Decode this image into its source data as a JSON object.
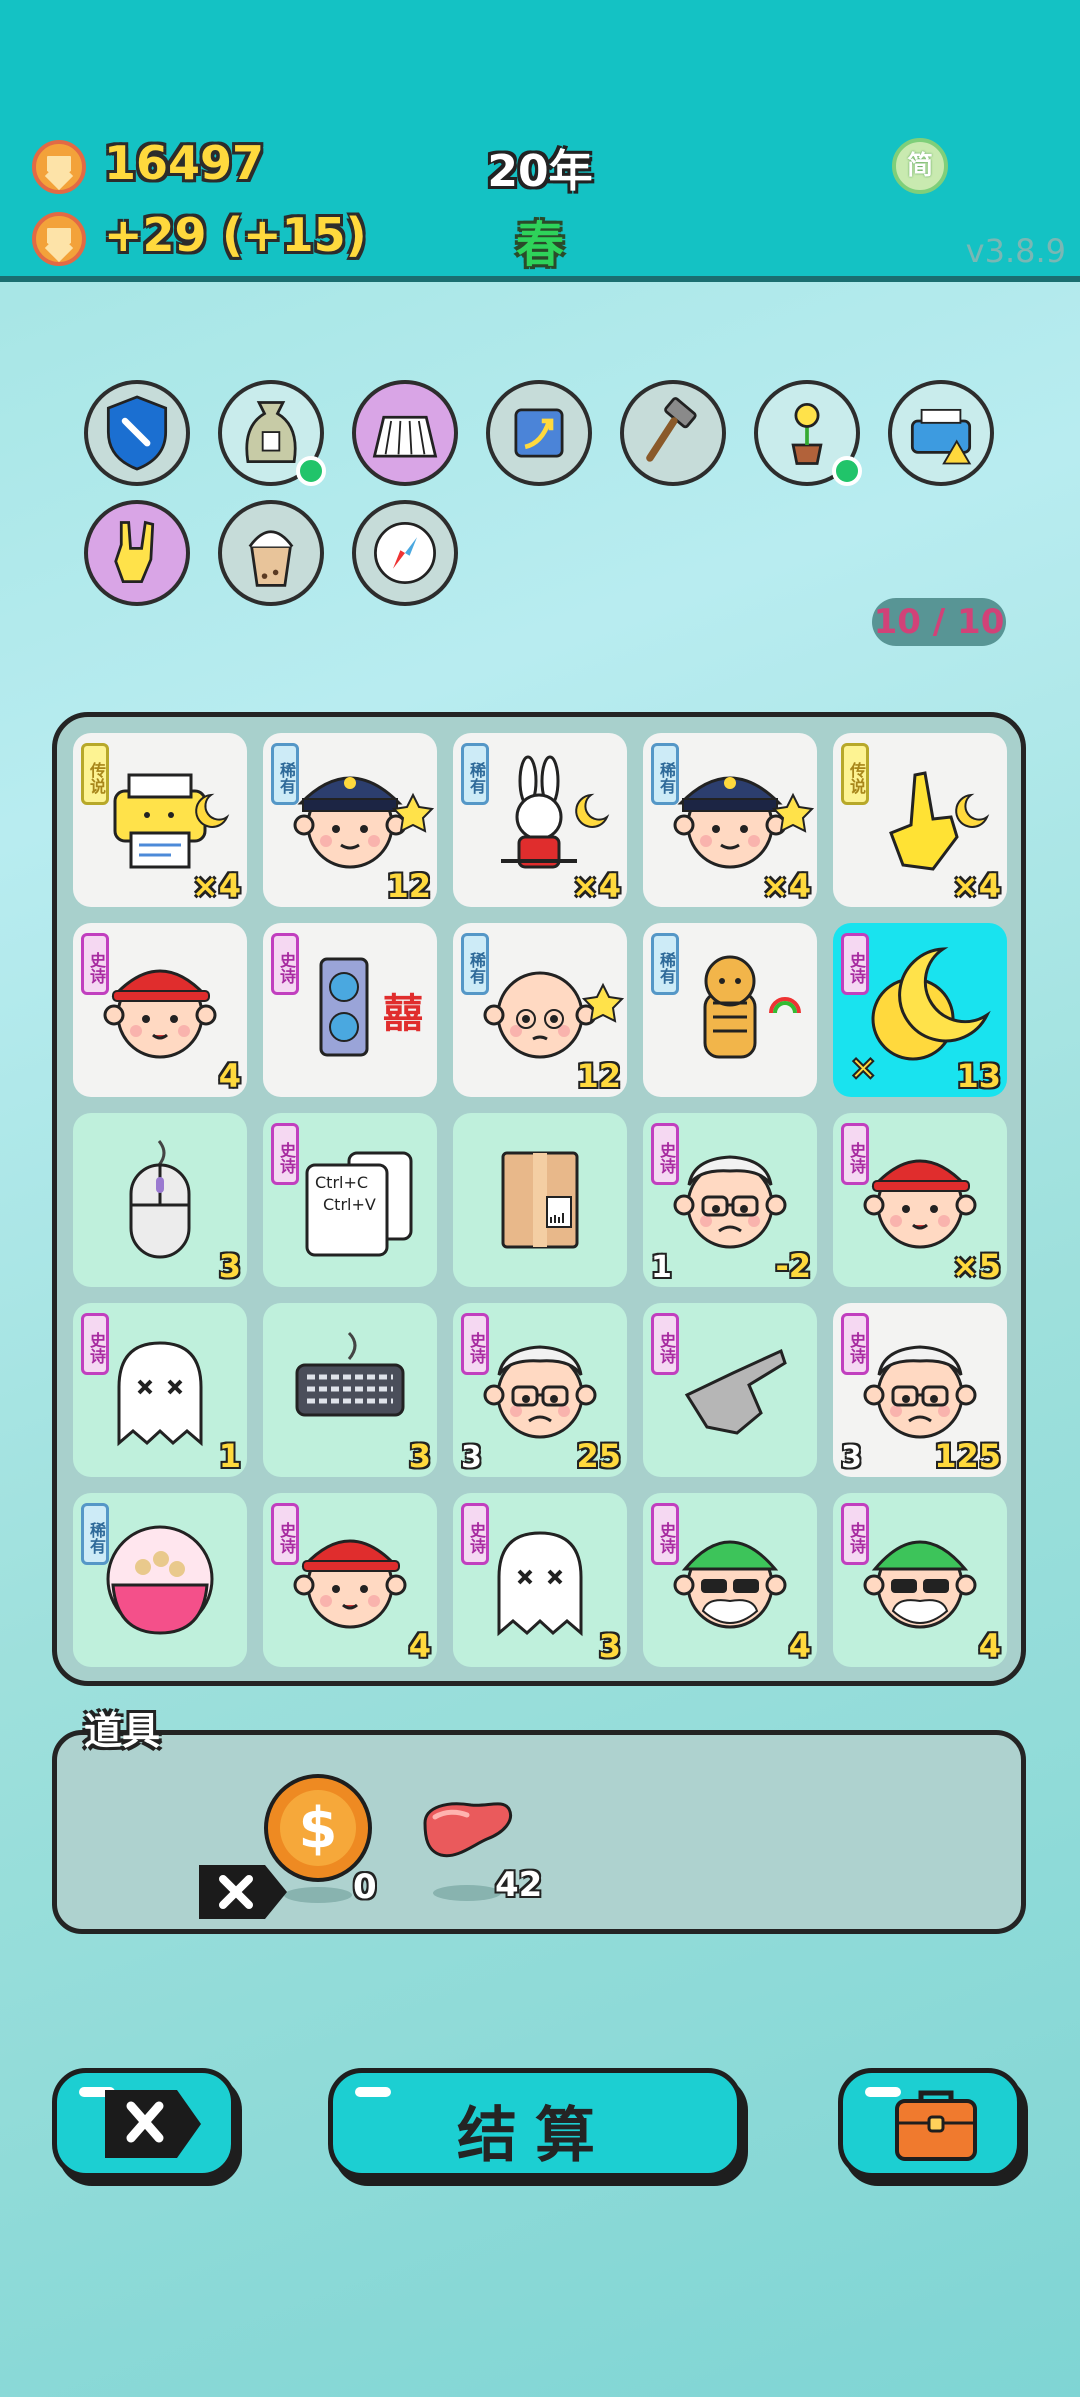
{
  "header": {
    "coins": "16497",
    "income": "+29",
    "bonus": "(+15)",
    "year": "20年",
    "season": "春",
    "lang_toggle": "简",
    "version": "v3.8.9"
  },
  "relics": [
    {
      "name": "shield-wrench",
      "bg": "#c6dcd9"
    },
    {
      "name": "money-bag",
      "bg": "#c9ecec",
      "dot": true
    },
    {
      "name": "pleated-skirt",
      "bg": "#d9a5e6"
    },
    {
      "name": "growth-arrow",
      "bg": "#c6dcd9"
    },
    {
      "name": "hammer",
      "bg": "#c6dcd9"
    },
    {
      "name": "potted-flower",
      "bg": "#c9ecec",
      "dot": true
    },
    {
      "name": "broken-printer",
      "bg": "#c9ecec"
    },
    {
      "name": "rock-hand",
      "bg": "#d9a5e6"
    },
    {
      "name": "bubble-tea",
      "bg": "#c6dcd9"
    },
    {
      "name": "compass",
      "bg": "#c6dcd9"
    }
  ],
  "relic_counter": "10 / 10",
  "grid": [
    {
      "item": "printer",
      "tag": "传说",
      "rarity": "legend",
      "count": "×4",
      "bg": "white"
    },
    {
      "item": "police",
      "tag": "稀有",
      "rarity": "rare",
      "count": "12",
      "bg": "white"
    },
    {
      "item": "rabbit",
      "tag": "稀有",
      "rarity": "rare",
      "count": "×4",
      "bg": "white"
    },
    {
      "item": "police",
      "tag": "稀有",
      "rarity": "rare",
      "count": "×4",
      "bg": "white"
    },
    {
      "item": "pointing-hand",
      "tag": "传说",
      "rarity": "legend",
      "count": "×4",
      "bg": "white"
    },
    {
      "item": "red-hat-boy",
      "tag": "史诗",
      "rarity": "epic",
      "count": "4",
      "bg": "white"
    },
    {
      "item": "gpu",
      "tag": "史诗",
      "rarity": "epic",
      "count": "",
      "bg": "white"
    },
    {
      "item": "bald-man",
      "tag": "稀有",
      "rarity": "rare",
      "count": "12",
      "bg": "white"
    },
    {
      "item": "tiger",
      "tag": "稀有",
      "rarity": "rare",
      "count": "",
      "bg": "white"
    },
    {
      "item": "moon-coin",
      "tag": "史诗",
      "rarity": "epic",
      "count": "13",
      "bg": "cyan"
    },
    {
      "item": "mouse",
      "tag": "",
      "rarity": "",
      "count": "3",
      "bg": "green"
    },
    {
      "item": "ctrl-cv",
      "tag": "史诗",
      "rarity": "epic",
      "count": "",
      "bg": "green",
      "text1": "Ctrl+C",
      "text2": "Ctrl+V"
    },
    {
      "item": "parcel",
      "tag": "",
      "rarity": "",
      "count": "",
      "bg": "green"
    },
    {
      "item": "old-man",
      "tag": "史诗",
      "rarity": "epic",
      "count": "-2",
      "left": "1",
      "bg": "green"
    },
    {
      "item": "red-hat-boy",
      "tag": "史诗",
      "rarity": "epic",
      "count": "×5",
      "bg": "green"
    },
    {
      "item": "ghost",
      "tag": "史诗",
      "rarity": "epic",
      "count": "1",
      "bg": "green"
    },
    {
      "item": "keyboard",
      "tag": "",
      "rarity": "",
      "count": "3",
      "bg": "green"
    },
    {
      "item": "old-man",
      "tag": "史诗",
      "rarity": "epic",
      "count": "25",
      "left": "3",
      "bg": "green"
    },
    {
      "item": "gray-hand",
      "tag": "史诗",
      "rarity": "epic",
      "count": "",
      "bg": "green"
    },
    {
      "item": "old-man",
      "tag": "史诗",
      "rarity": "epic",
      "count": "125",
      "left": "3",
      "bg": "white"
    },
    {
      "item": "bowl",
      "tag": "稀有",
      "rarity": "rare",
      "count": "",
      "bg": "green"
    },
    {
      "item": "red-hat-boy",
      "tag": "史诗",
      "rarity": "epic",
      "count": "4",
      "bg": "green"
    },
    {
      "item": "ghost",
      "tag": "史诗",
      "rarity": "epic",
      "count": "3",
      "bg": "green"
    },
    {
      "item": "green-hat-man",
      "tag": "史诗",
      "rarity": "epic",
      "count": "4",
      "bg": "green"
    },
    {
      "item": "green-hat-man",
      "tag": "史诗",
      "rarity": "epic",
      "count": "4",
      "bg": "green"
    }
  ],
  "items_panel": {
    "title": "道具",
    "dollar_count": "0",
    "liver_count": "42"
  },
  "buttons": {
    "settle": "结算"
  }
}
